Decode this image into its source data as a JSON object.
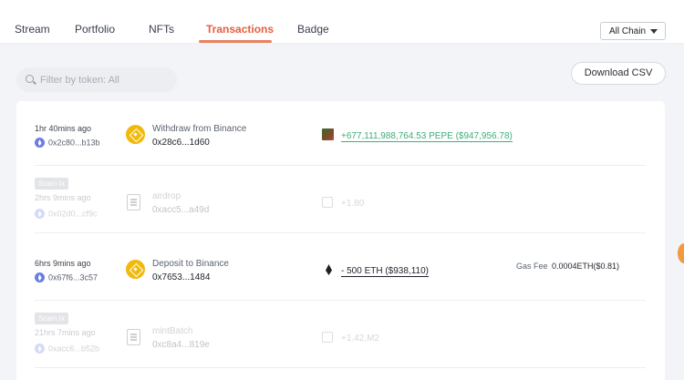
{
  "tabs": [
    {
      "label": "Stream"
    },
    {
      "label": "Portfolio"
    },
    {
      "label": "NFTs"
    },
    {
      "label": "Transactions"
    },
    {
      "label": "Badge"
    }
  ],
  "active_tab": "Transactions",
  "chain_select": {
    "value": "All Chain"
  },
  "filter": {
    "placeholder": "Filter by token: All"
  },
  "download_button": "Download CSV",
  "transactions": [
    {
      "time": "1hr 40mins ago",
      "address": "0x2c80...b13b",
      "label": "Withdraw from Binance",
      "hash": "0x28c6...1d60",
      "amount": "+677,111,988,764.53 PEPE ($947,956.78)",
      "amount_color": "#3dae79"
    },
    {
      "scam_badge": "Scam tx",
      "time": "2hrs 9mins ago",
      "address": "0x02d0...cf9c",
      "label": "airdrop",
      "hash": "0xacc5...a49d",
      "amount": "+1.80"
    },
    {
      "time": "6hrs 9mins ago",
      "address": "0x67f6...3c57",
      "label": "Deposit to Binance",
      "hash": "0x7653...1484",
      "amount": "- 500 ETH ($938,110)",
      "gas_label": "Gas Fee",
      "gas_value": "0.0004ETH($0.81)"
    },
    {
      "scam_badge": "Scam tx",
      "time": "21hrs 7mins ago",
      "address": "0xacc6...b52b",
      "label": "mintBatch",
      "hash": "0xc8a4...819e",
      "amount": "+1.42,M2"
    }
  ],
  "icons": {
    "search": "search-icon",
    "chain_dropdown": "chevron-down-icon",
    "binance": "binance-icon",
    "contract": "contract-icon",
    "ethereum": "ethereum-icon",
    "token_pepe": "pepe-token-icon"
  },
  "colors": {
    "accent": "#e85d3a",
    "gain": "#3dae79",
    "binance": "#f0b90b"
  }
}
